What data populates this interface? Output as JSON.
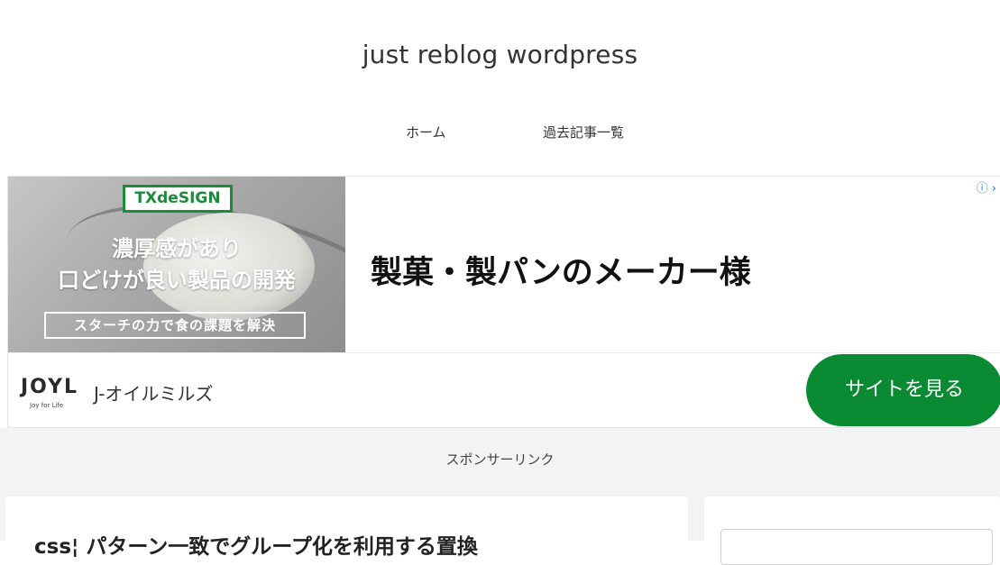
{
  "site": {
    "title": "just reblog wordpress"
  },
  "nav": {
    "items": [
      {
        "label": "ホーム"
      },
      {
        "label": "過去記事一覧"
      }
    ]
  },
  "ad": {
    "brand_badge": "TXdeSIGN",
    "image_line1": "濃厚感があり",
    "image_line2": "口どけが良い製品の開発",
    "image_box": "スターチの力で食の課題を解決",
    "headline": "製菓・製パンのメーカー様",
    "choices_icon": "adchoices-icon",
    "choices_text": "ⓘ ›",
    "advertiser_logo": "JOYL",
    "advertiser_tagline": "Joy for Life",
    "advertiser_name": "J-オイルミルズ",
    "cta_label": "サイトを見る",
    "cta_color": "#0a8a33",
    "brand_color": "#1e8a3c"
  },
  "content": {
    "sponsor_label": "スポンサーリンク",
    "post_title": "css¦ パターン一致でグループ化を利用する置換"
  }
}
